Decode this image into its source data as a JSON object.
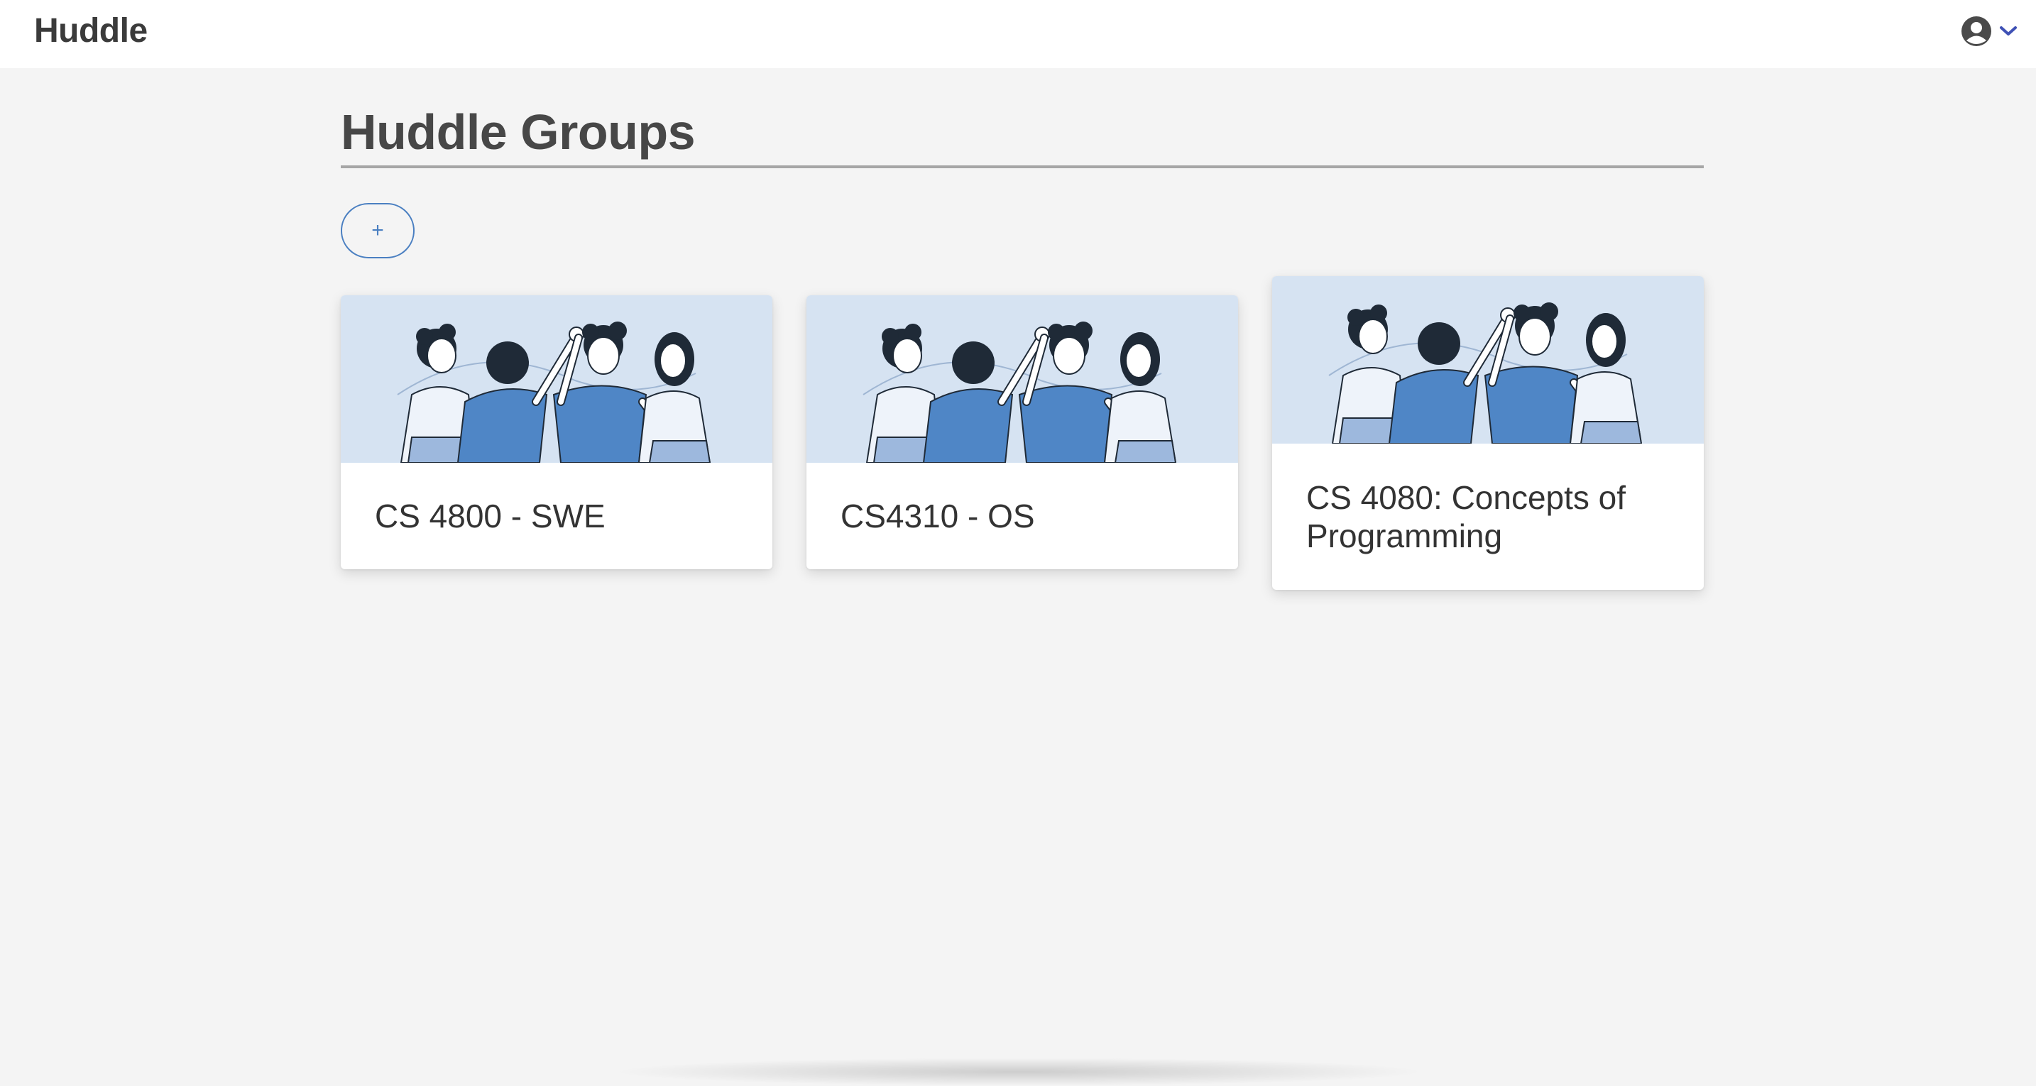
{
  "navbar": {
    "brand": "Huddle",
    "account_icon": "user-circle-icon",
    "dropdown_icon": "chevron-down-icon",
    "accent_color": "#3f51b5"
  },
  "main": {
    "title": "Huddle Groups",
    "add_button_label": "+",
    "groups": [
      {
        "name": "CS 4800 - SWE",
        "image": "team-high-five-illustration"
      },
      {
        "name": "CS4310 - OS",
        "image": "team-high-five-illustration"
      },
      {
        "name": "CS 4080: Concepts of Programming",
        "image": "team-high-five-illustration"
      }
    ]
  },
  "colors": {
    "background": "#f4f4f4",
    "card_image_bg": "#d6e3f2",
    "illustration_blue": "#4f86c6",
    "illustration_dark": "#1f2a37",
    "button_outline": "#4a7fc1"
  }
}
